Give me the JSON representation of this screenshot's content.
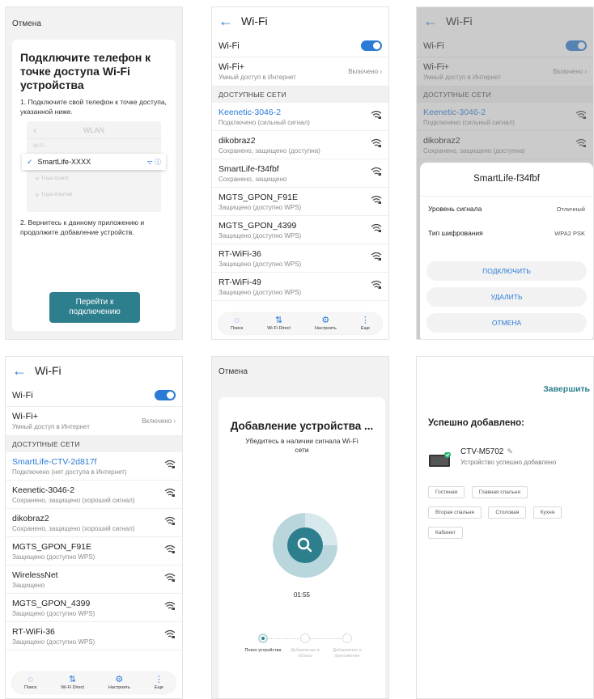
{
  "panel1": {
    "cancel": "Отмена",
    "title": "Подключите телефон к точке доступа Wi-Fi устройства",
    "step1": "1. Подключите свой телефон к точке доступа, указанной ниже.",
    "mini": {
      "title": "WLAN",
      "faded_top": "Wi-Fi",
      "selected": "SmartLife-XXXX",
      "other1": "Tuya-Guest",
      "other2": "Tuya-Internet"
    },
    "step2": "2. Вернитесь к данному приложению и продолжите добавление устройств.",
    "button": "Перейти к подключению"
  },
  "wifi_common": {
    "title": "Wi-Fi",
    "wifi_label": "Wi-Fi",
    "wifiplus_label": "Wi-Fi+",
    "wifiplus_sub": "Умный доступ в Интернет",
    "wifiplus_state": "Включено",
    "section": "ДОСТУПНЫЕ СЕТИ",
    "bottom": [
      "Поиск",
      "Wi-Fi Direct",
      "Настроить",
      "Еще"
    ]
  },
  "panel2": {
    "networks": [
      {
        "name": "Keenetic-3046-2",
        "desc": "Подключено (сильный сигнал)"
      },
      {
        "name": "dikobraz2",
        "desc": "Сохранено, защищено (доступна)"
      },
      {
        "name": "SmartLife-f34fbf",
        "desc": "Сохранено, защищено"
      },
      {
        "name": "MGTS_GPON_F91E",
        "desc": "Защищено (доступно WPS)"
      },
      {
        "name": "MGTS_GPON_4399",
        "desc": "Защищено (доступно WPS)"
      },
      {
        "name": "RT-WiFi-36",
        "desc": "Защищено (доступно WPS)"
      },
      {
        "name": "RT-WiFi-49",
        "desc": "Защищено (доступно WPS)"
      }
    ]
  },
  "panel3": {
    "networks": [
      {
        "name": "Keenetic-3046-2",
        "desc": "Подключено (сильный сигнал)"
      },
      {
        "name": "dikobraz2",
        "desc": "Сохранено, защищено (доступна)"
      }
    ],
    "dialog": {
      "title": "SmartLife-f34fbf",
      "signal_label": "Уровень сигнала",
      "signal_value": "Отличный",
      "enc_label": "Тип шифрования",
      "enc_value": "WPA2 PSK",
      "connect": "ПОДКЛЮЧИТЬ",
      "delete": "УДАЛИТЬ",
      "cancel": "ОТМЕНА"
    }
  },
  "panel4": {
    "networks": [
      {
        "name": "SmartLife-CTV-2d817f",
        "desc": "Подключено (нет доступа в Интернет)"
      },
      {
        "name": "Keenetic-3046-2",
        "desc": "Сохранено, защищено (хороший сигнал)"
      },
      {
        "name": "dikobraz2",
        "desc": "Сохранено, защищено (хороший сигнал)"
      },
      {
        "name": "MGTS_GPON_F91E",
        "desc": "Защищено (доступно WPS)"
      },
      {
        "name": "WirelessNet",
        "desc": "Защищено"
      },
      {
        "name": "MGTS_GPON_4399",
        "desc": "Защищено (доступно WPS)"
      },
      {
        "name": "RT-WiFi-36",
        "desc": "Защищено (доступно WPS)"
      }
    ]
  },
  "panel5": {
    "cancel": "Отмена",
    "title": "Добавление устройства ...",
    "subtitle": "Убедитесь в наличии сигнала Wi-Fi сети",
    "timer": "01:55",
    "steps": [
      "Поиск устройства",
      "Добавление в облако",
      "Добавление в приложение"
    ]
  },
  "panel6": {
    "done": "Завершить",
    "heading": "Успешно добавлено:",
    "device": "CTV-M5702",
    "device_status": "Устройство успешно добавлено",
    "rooms": [
      "Гостиная",
      "Главная спальня",
      "Вторая спальня",
      "Столовая",
      "Кухня",
      "Кабинет"
    ]
  },
  "colors": {
    "accent": "#2a7ad6",
    "teal": "#2e7f8e"
  }
}
